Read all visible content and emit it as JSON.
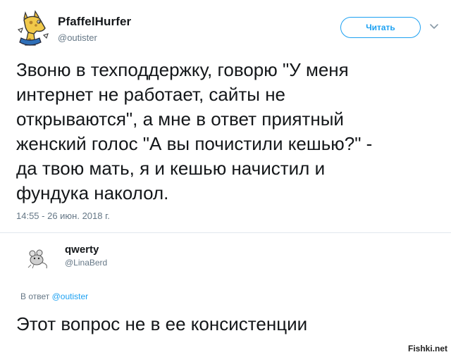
{
  "tweet": {
    "user_name": "PfaffelHurfer",
    "user_handle": "@outister",
    "follow_label": "Читать",
    "text": "Звоню в техподдержку, говорю \"У меня\nинтернет не работает, сайты не\nоткрываются\", а мне в ответ приятный\nженский голос \"А вы почистили кешью?\" -\nда твою мать, я и кешью начистил и\nфундука наколол.",
    "timestamp": "14:55 - 26 июн. 2018 г."
  },
  "reply": {
    "user_name": "qwerty",
    "user_handle": "@LinaBerd",
    "reply_prefix": "В ответ",
    "reply_mention": "@outister",
    "text": "Этот вопрос не в ее консистенции"
  },
  "watermark": "Fishki.net",
  "colors": {
    "accent": "#1da1f2",
    "secondary_text": "#657786",
    "primary_text": "#14171a",
    "divider": "#e1e8ed"
  },
  "icons": {
    "avatar_main": "giraffe-avatar-icon",
    "avatar_reply": "rat-avatar-icon",
    "menu": "chevron-down-icon"
  }
}
